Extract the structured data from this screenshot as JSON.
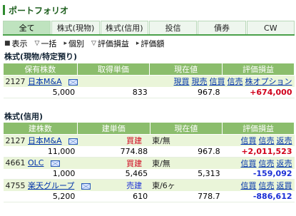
{
  "header": {
    "title": "ポートフォリオ"
  },
  "tabs": [
    {
      "label": "全て"
    },
    {
      "label": "株式(現物)"
    },
    {
      "label": "株式(信用)"
    },
    {
      "label": "投信"
    },
    {
      "label": "債券"
    },
    {
      "label": "CW"
    }
  ],
  "toolbar": {
    "display": "表示",
    "list": "一括",
    "individual": "個別",
    "valuation": "評価損益",
    "amount": "評価額"
  },
  "cash_section": {
    "title": "株式(現物/特定預り)",
    "headers": [
      "保有株数",
      "取得単価",
      "現在値",
      "評価損益"
    ],
    "rows": [
      {
        "code": "2127",
        "name": "日本M&A",
        "links": [
          "現買",
          "現売",
          "信買",
          "信売",
          "株オプション"
        ],
        "shares": "5,000",
        "cost": "833",
        "price": "967.8",
        "pl": "+674,000"
      }
    ]
  },
  "margin_section": {
    "title": "株式(信用)",
    "headers": [
      "建株数",
      "建単価",
      "現在値",
      "評価損益"
    ],
    "rows": [
      {
        "code": "2127",
        "name": "日本M&A",
        "side": "買建",
        "cond": "東/無",
        "links": [
          "信買",
          "信売",
          "返売"
        ],
        "shares": "11,000",
        "cost": "774.88",
        "price": "967.8",
        "pl": "+2,011,523"
      },
      {
        "code": "4661",
        "name": "OLC",
        "side": "買建",
        "cond": "東/無",
        "links": [
          "信買",
          "信売",
          "返売"
        ],
        "shares": "1,000",
        "cost": "5,465",
        "price": "5,313",
        "pl": "-159,092"
      },
      {
        "code": "4755",
        "name": "楽天グループ",
        "side": "売建",
        "cond": "東/6ヶ",
        "links": [
          "信買",
          "信売",
          "返買"
        ],
        "shares": "5,200",
        "cost": "610",
        "price": "778.7",
        "pl": "-886,612"
      }
    ]
  },
  "colors": {
    "accent": "#4aa04a",
    "header_bg": "#8bbd6c",
    "row_bg": "#eaf5d9",
    "profit": "#d0021b",
    "loss": "#1a2fd6"
  }
}
